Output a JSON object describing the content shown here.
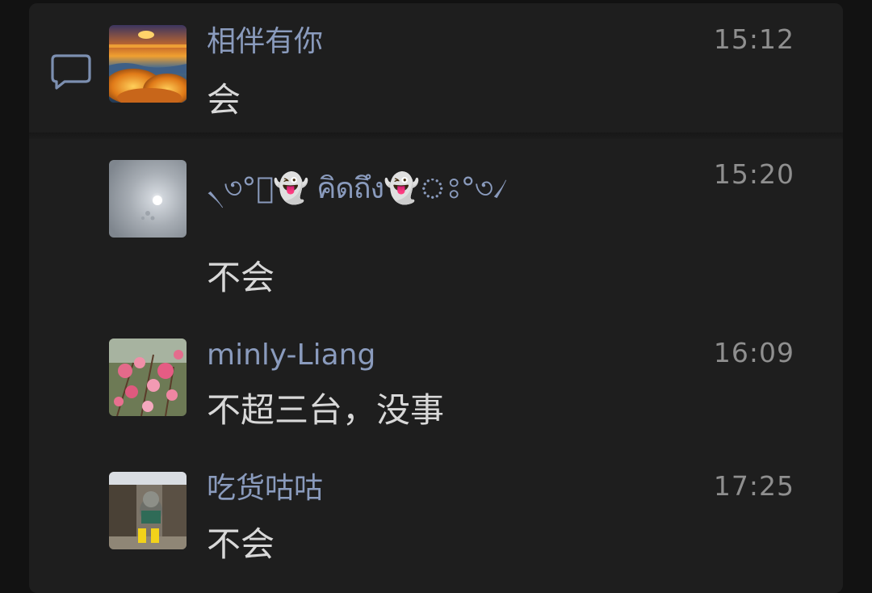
{
  "comments": [
    {
      "name": "相伴有你",
      "time": "15:12",
      "text": "会",
      "avatar": "sunset-clouds-avatar",
      "show_comment_icon": true
    },
    {
      "name": "৲৩°ঃ👻 คิดถึง👻ঃ°৩৴",
      "time": "15:20",
      "text": "不会",
      "avatar": "moon-sky-avatar"
    },
    {
      "name": "minly-Liang",
      "time": "16:09",
      "text": "不超三台，没事",
      "avatar": "pink-blossom-avatar"
    },
    {
      "name": "吃货咕咕",
      "time": "17:25",
      "text": "不会",
      "avatar": "cat-yellow-boots-avatar"
    }
  ],
  "colors": {
    "background": "#121212",
    "panel": "#1e1e1e",
    "name": "#8a9bbd",
    "time": "#8f8f8f",
    "message": "#d8d8d8",
    "icon": "#7c8fb0"
  },
  "icons": {
    "comment": "comment-bubble-icon"
  }
}
